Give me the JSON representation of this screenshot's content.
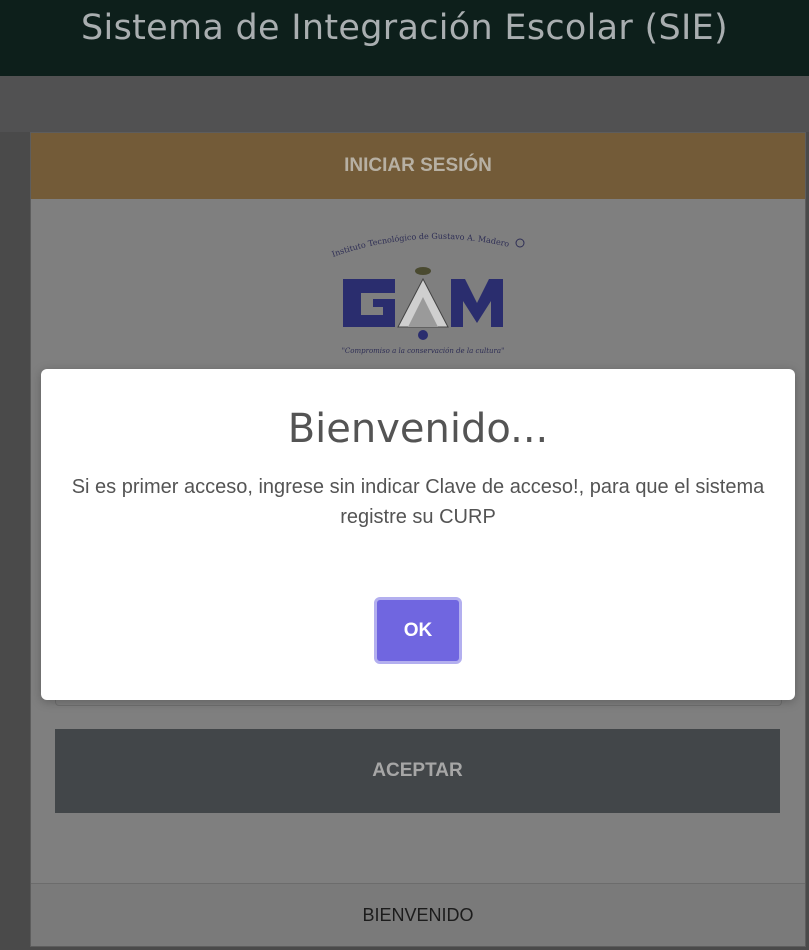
{
  "header": {
    "title": "Sistema de Integración Escolar (SIE)"
  },
  "login_card": {
    "header_label": "INICIAR SESIÓN",
    "logo": {
      "top_text": "Instituto Tecnológico de Gustavo A. Madero",
      "letters": "GAM",
      "motto": "\"Compromiso a la conservación de la cultura\""
    },
    "submit_label": "ACEPTAR",
    "footer_text": "BIENVENIDO"
  },
  "modal": {
    "title": "Bienvenido...",
    "message": "Si es primer acceso, ingrese sin indicar Clave de acceso!, para que el sistema registre su CURP",
    "ok_label": "OK"
  },
  "colors": {
    "header_bg": "#0d1f1b",
    "card_header_bg": "#735b38",
    "ok_button": "#7066e0",
    "login_button": "#424649"
  }
}
